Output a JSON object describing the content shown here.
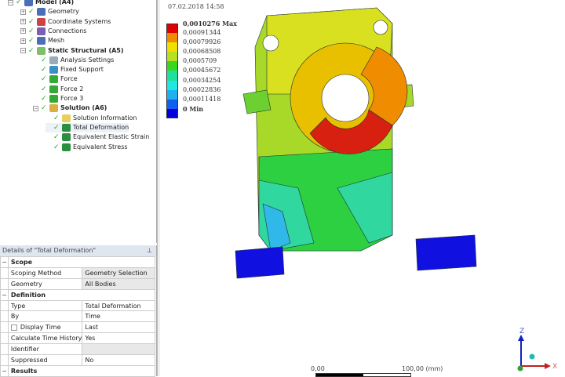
{
  "tree": {
    "items": [
      {
        "label": "Model (A4)",
        "level": 0,
        "bold": true,
        "color": "#4a6fb5"
      },
      {
        "label": "Geometry",
        "level": 1,
        "color": "#4a6fb5"
      },
      {
        "label": "Coordinate Systems",
        "level": 1,
        "color": "#c44"
      },
      {
        "label": "Connections",
        "level": 1,
        "color": "#7a5fb5"
      },
      {
        "label": "Mesh",
        "level": 1,
        "color": "#4a6fb5"
      },
      {
        "label": "Static Structural (A5)",
        "level": 1,
        "bold": true,
        "color": "#7cc06a"
      },
      {
        "label": "Analysis Settings",
        "level": 2,
        "color": "#9ab"
      },
      {
        "label": "Fixed Support",
        "level": 2,
        "color": "#3a8fc5"
      },
      {
        "label": "Force",
        "level": 2,
        "color": "#3a3"
      },
      {
        "label": "Force 2",
        "level": 2,
        "color": "#3a3"
      },
      {
        "label": "Force 3",
        "level": 2,
        "color": "#3a3"
      },
      {
        "label": "Solution (A6)",
        "level": 2,
        "bold": true,
        "color": "#d8b040"
      },
      {
        "label": "Solution Information",
        "level": 3,
        "color": "#e8d060"
      },
      {
        "label": "Total Deformation",
        "level": 3,
        "color": "#2a8f3f",
        "selected": true
      },
      {
        "label": "Equivalent Elastic Strain",
        "level": 3,
        "color": "#2a8f3f"
      },
      {
        "label": "Equivalent Stress",
        "level": 3,
        "color": "#2a8f3f"
      }
    ]
  },
  "details": {
    "title": "Details of \"Total Deformation\"",
    "pin": "⊥",
    "scope": "Scope",
    "scoping_method_label": "Scoping Method",
    "scoping_method": "Geometry Selection",
    "geometry_label": "Geometry",
    "geometry": "All Bodies",
    "definition": "Definition",
    "type_label": "Type",
    "type": "Total Deformation",
    "by_label": "By",
    "by": "Time",
    "display_time_label": "Display Time",
    "display_time": "Last",
    "calc_label": "Calculate Time History",
    "calc": "Yes",
    "identifier_label": "Identifier",
    "identifier": "",
    "suppressed_label": "Suppressed",
    "suppressed": "No",
    "results": "Results"
  },
  "graphics": {
    "date": "07.02.2018 14:58",
    "legend": [
      {
        "label": "0,0010276 Max",
        "color": "#e00000"
      },
      {
        "label": "0,00091344",
        "color": "#f08c00"
      },
      {
        "label": "0,00079926",
        "color": "#f0e000"
      },
      {
        "label": "0,00068508",
        "color": "#b8e020"
      },
      {
        "label": "0,0005709",
        "color": "#38d820"
      },
      {
        "label": "0,00045672",
        "color": "#20e0a0"
      },
      {
        "label": "0,00034254",
        "color": "#20e8e0"
      },
      {
        "label": "0,00022836",
        "color": "#20b0f0"
      },
      {
        "label": "0,00011418",
        "color": "#1060f0"
      },
      {
        "label": "0 Min",
        "color": "#0000e0"
      }
    ],
    "scale_min": "0,00",
    "scale_max": "100,00 (mm)",
    "axis_z": "Z",
    "axis_x": "X"
  }
}
